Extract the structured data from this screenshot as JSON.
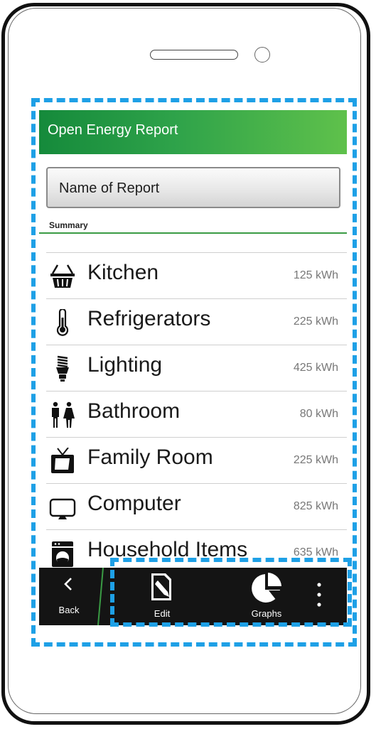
{
  "header": {
    "title": "Open Energy Report"
  },
  "report_name_button": {
    "label": "Name of Report"
  },
  "summary": {
    "label": "Summary"
  },
  "items": [
    {
      "label": "Kitchen",
      "value": "125 kWh",
      "icon": "basket-icon"
    },
    {
      "label": "Refrigerators",
      "value": "225 kWh",
      "icon": "thermometer-icon"
    },
    {
      "label": "Lighting",
      "value": "425 kWh",
      "icon": "lightbulb-icon"
    },
    {
      "label": "Bathroom",
      "value": "80 kWh",
      "icon": "restroom-icon"
    },
    {
      "label": "Family Room",
      "value": "225 kWh",
      "icon": "tv-icon"
    },
    {
      "label": "Computer",
      "value": "825 kWh",
      "icon": "monitor-icon"
    },
    {
      "label": "Household Items",
      "value": "635 kWh",
      "icon": "washing-machine-icon"
    }
  ],
  "action_bar": {
    "back_label": "Back",
    "edit_label": "Edit",
    "graphs_label": "Graphs"
  },
  "colors": {
    "header_start": "#158a3b",
    "header_end": "#5fc14b",
    "annotation": "#1ea0e6",
    "action_bar": "#141414"
  }
}
